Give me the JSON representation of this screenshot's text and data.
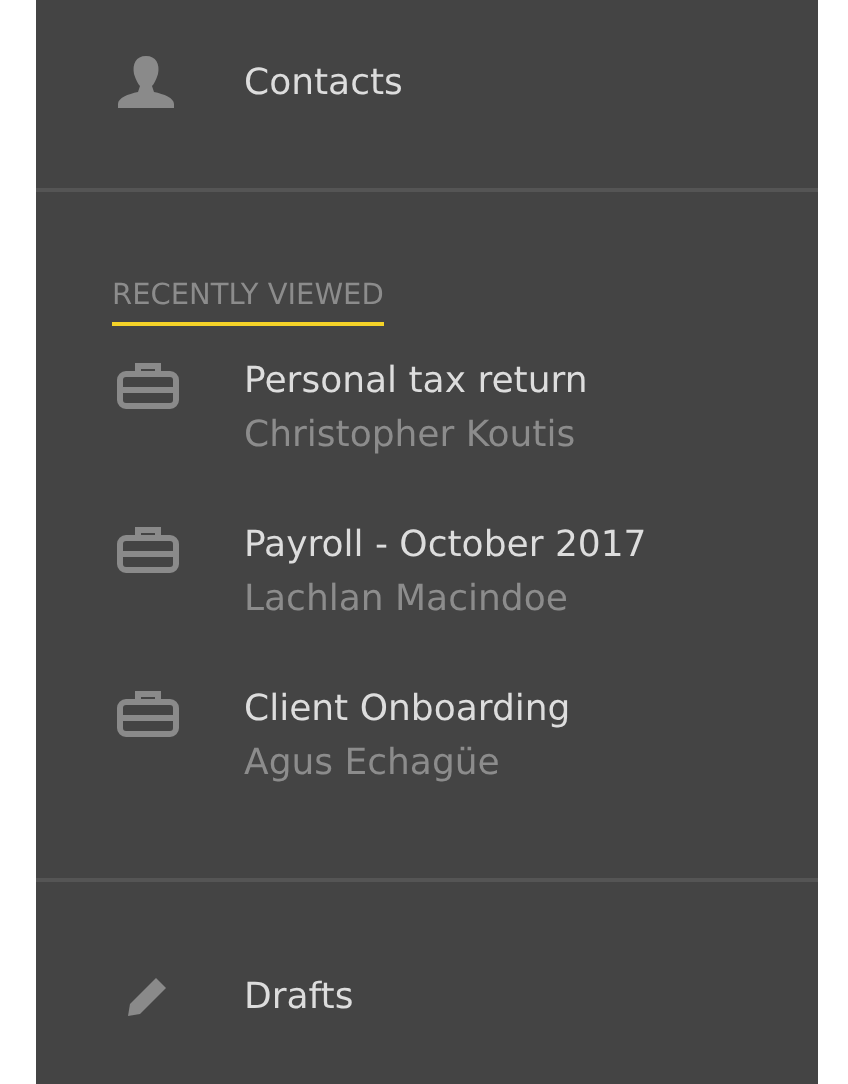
{
  "nav_top": [
    {
      "label": "Contacts",
      "kind": "person"
    }
  ],
  "recently_viewed": {
    "heading": "RECENTLY VIEWED",
    "items": [
      {
        "title": "Personal tax return",
        "subtitle": "Christopher Koutis"
      },
      {
        "title": "Payroll - October 2017",
        "subtitle": "Lachlan Macindoe"
      },
      {
        "title": "Client Onboarding",
        "subtitle": "Agus Echagüe"
      }
    ]
  },
  "nav_bottom": [
    {
      "label": "Drafts",
      "kind": "pencil"
    }
  ]
}
